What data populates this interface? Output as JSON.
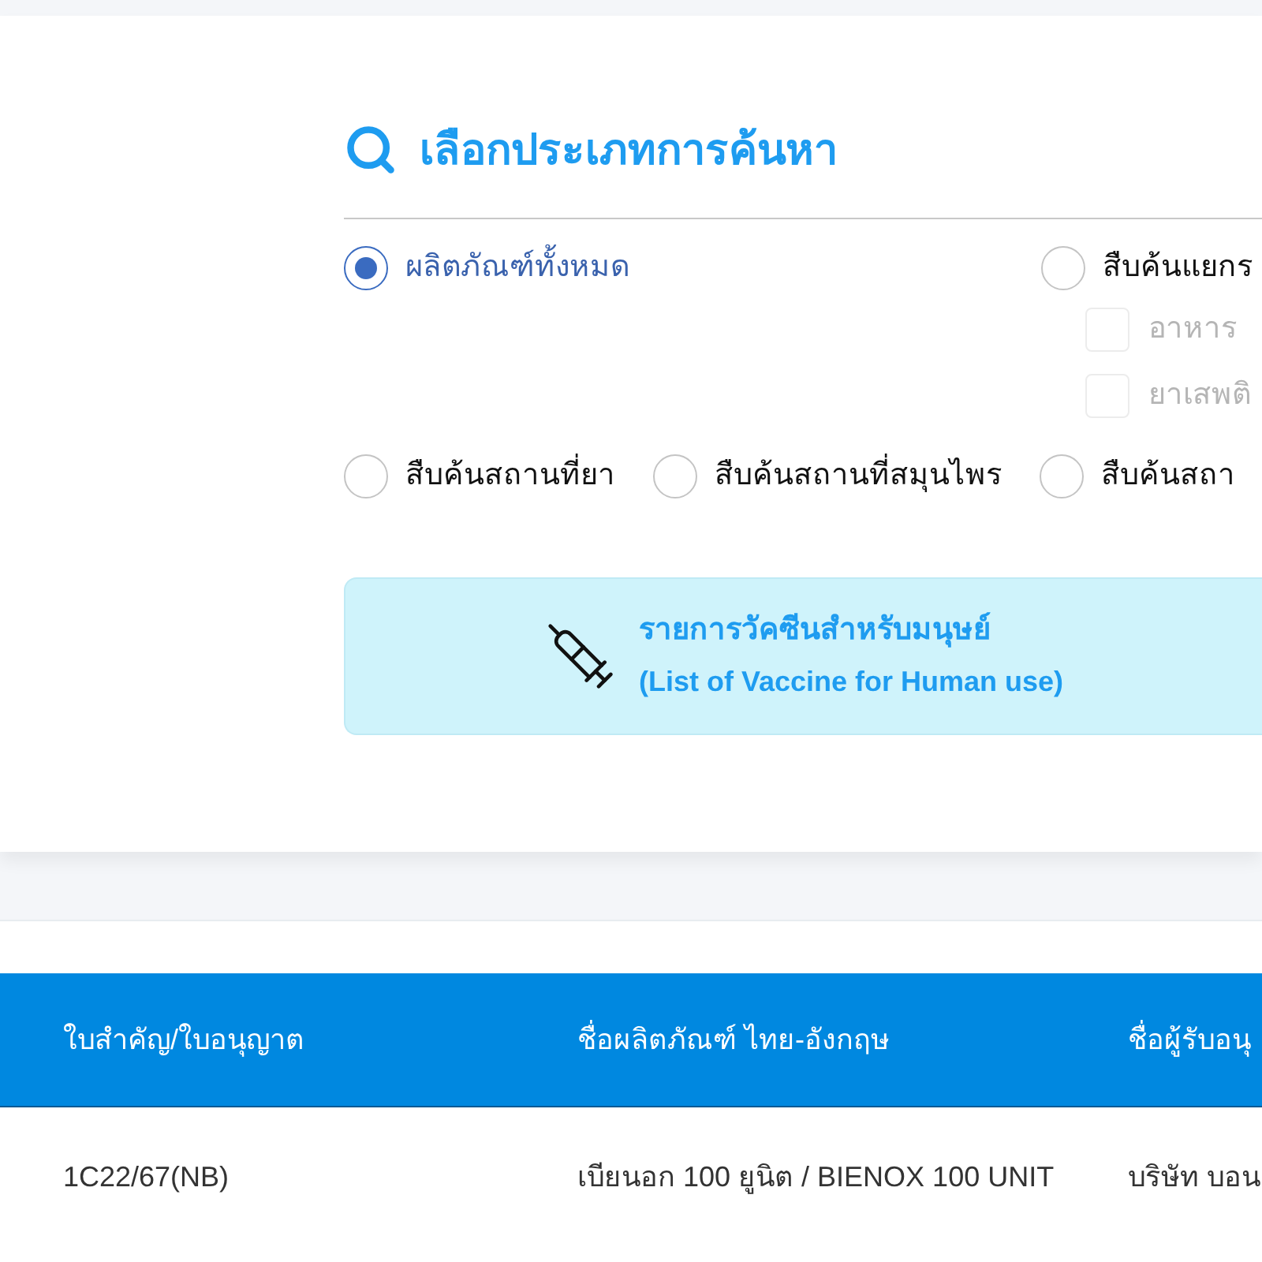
{
  "search_panel": {
    "title": "เลือกประเภทการค้นหา",
    "radio_rows": [
      [
        {
          "label": "ผลิตภัณฑ์ทั้งหมด",
          "selected": true
        },
        {
          "label": "สืบค้นแยกร",
          "selected": false,
          "sub_options": [
            {
              "label": "อาหาร",
              "checked": false,
              "disabled": true
            },
            {
              "label": "ยาเสพติ",
              "checked": false,
              "disabled": true
            }
          ]
        }
      ],
      [
        {
          "label": "สืบค้นสถานที่ยา",
          "selected": false
        },
        {
          "label": "สืบค้นสถานที่สมุนไพร",
          "selected": false
        },
        {
          "label": "สืบค้นสถา",
          "selected": false
        }
      ]
    ]
  },
  "vaccine_banner": {
    "title": "รายการวัคซีนสำหรับมนุษย์",
    "subtitle": "(List of Vaccine for Human use)"
  },
  "table": {
    "columns": [
      "ใบสำคัญ/ใบอนุญาต",
      "ชื่อผลิตภัณฑ์ ไทย-อังกฤษ",
      "ชื่อผู้รับอนุ"
    ],
    "rows": [
      [
        "1C22/67(NB)",
        "เบียนอก 100 ยูนิต / BIENOX 100 UNIT",
        "บริษัท บอน"
      ]
    ]
  }
}
